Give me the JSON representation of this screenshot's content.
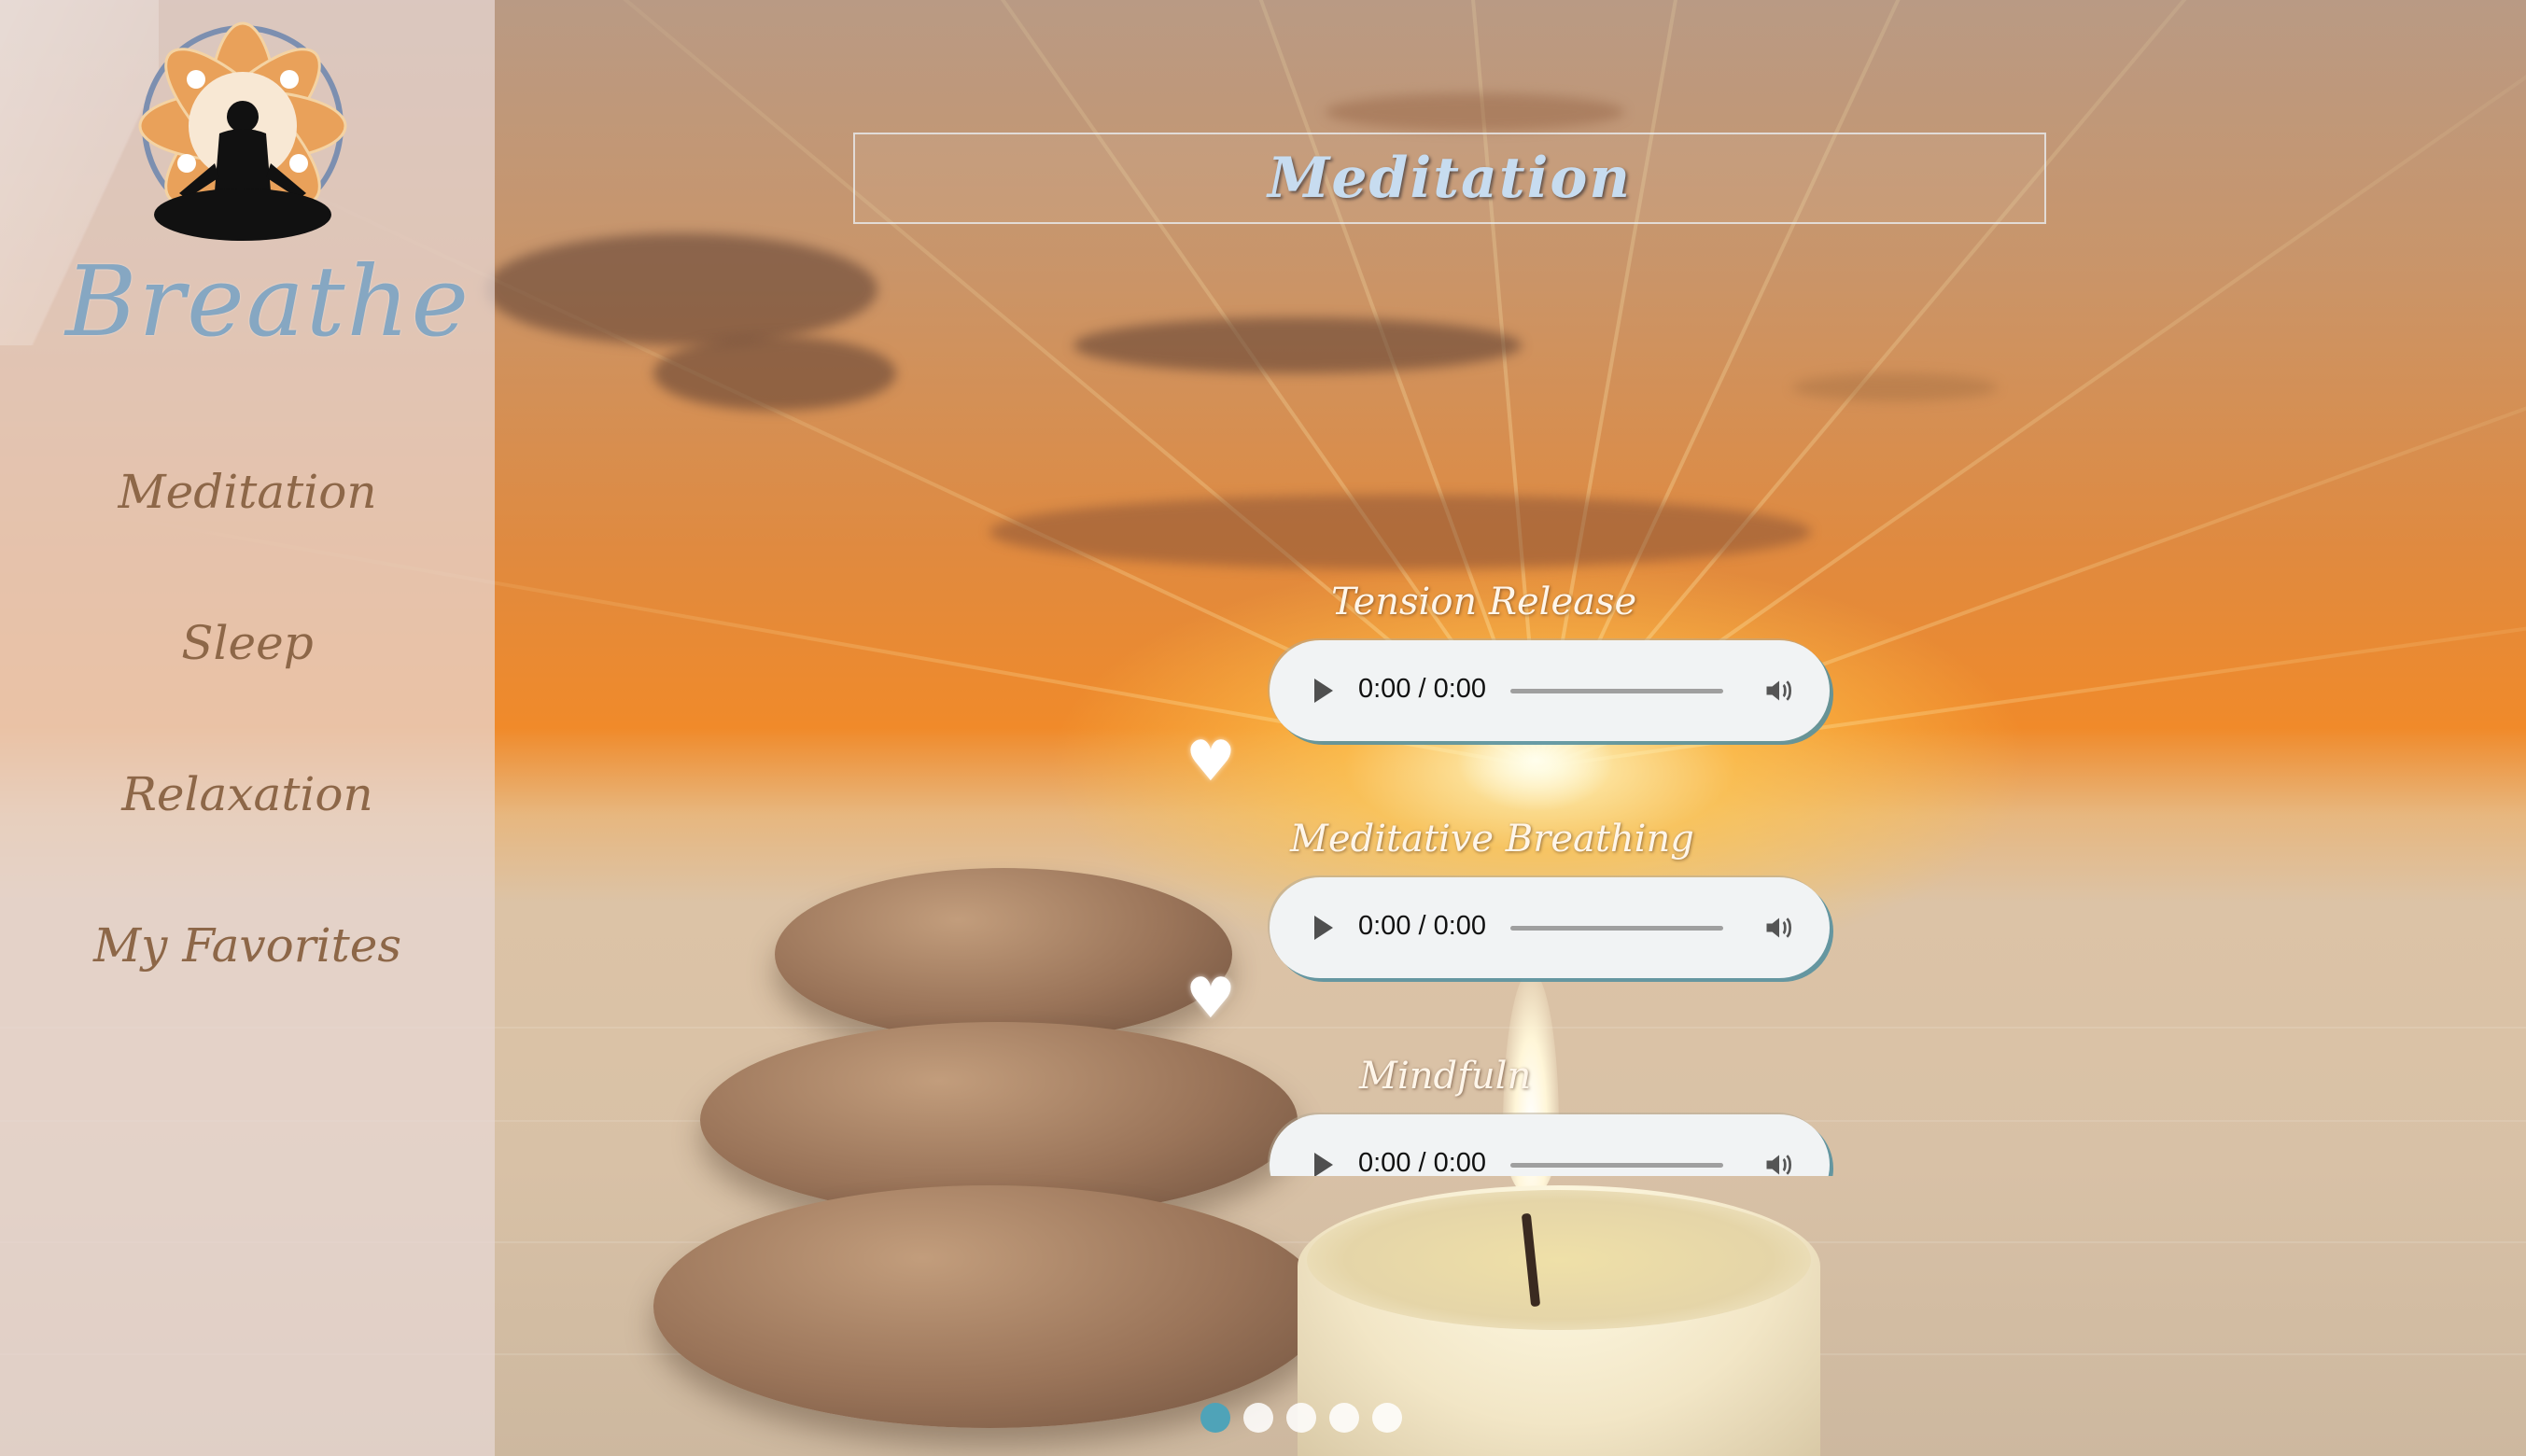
{
  "app": {
    "logo_text": "Breathe"
  },
  "nav": {
    "items": [
      {
        "label": "Meditation"
      },
      {
        "label": "Sleep"
      },
      {
        "label": "Relaxation"
      },
      {
        "label": "My Favorites"
      }
    ]
  },
  "page": {
    "title": "Meditation"
  },
  "tracks": [
    {
      "title": "Tension Release",
      "time": "0:00 / 0:00",
      "favorite_icon": "heart-icon"
    },
    {
      "title": "Meditative Breathing",
      "time": "0:00 / 0:00",
      "favorite_icon": "heart-icon"
    },
    {
      "title": "Mindfuln",
      "time": "0:00 / 0:00"
    }
  ],
  "carousel": {
    "slides": 5,
    "active_index": 0,
    "active_color": "#4fa3b8"
  },
  "colors": {
    "nav_text": "#8d6748",
    "title_text": "#c7dcf0",
    "logo_text": "#86a7c2"
  }
}
